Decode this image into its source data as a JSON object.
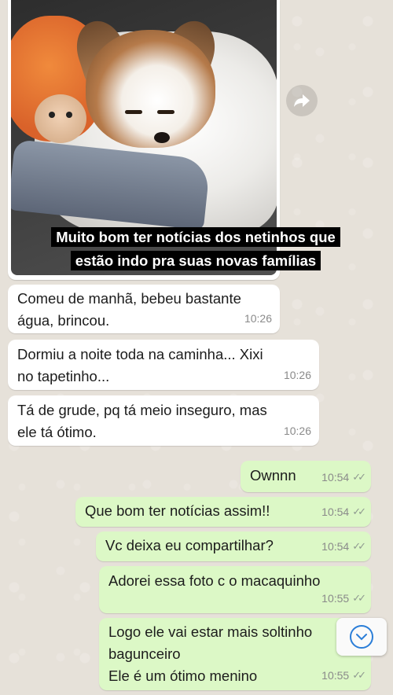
{
  "image_message": {
    "caption": "Muito bom ter notícias dos netinhos que estão indo pra suas novas famílias"
  },
  "icons": {
    "forward": "forward-arrow-icon",
    "scroll_down": "chevron-down-icon",
    "read_receipt": "double-check-icon"
  },
  "colors": {
    "incoming_bubble": "#ffffff",
    "outgoing_bubble": "#dcf8c6",
    "wallpaper": "#e6e1d9",
    "scroll_accent": "#2b7ed8"
  },
  "messages": [
    {
      "direction": "in",
      "text_lines": [
        "Comeu de manhã, bebeu bastante",
        "água, brincou."
      ],
      "time": "10:26"
    },
    {
      "direction": "in",
      "text_lines": [
        "Dormiu a noite toda na caminha... Xixi",
        "no tapetinho..."
      ],
      "time": "10:26"
    },
    {
      "direction": "in",
      "text_lines": [
        "Tá de grude, pq tá meio inseguro, mas",
        "ele tá ótimo."
      ],
      "time": "10:26"
    },
    {
      "direction": "out",
      "text_lines": [
        "Ownnn"
      ],
      "time": "10:54"
    },
    {
      "direction": "out",
      "text_lines": [
        "Que bom ter notícias assim!!"
      ],
      "time": "10:54"
    },
    {
      "direction": "out",
      "text_lines": [
        "Vc deixa eu compartilhar?"
      ],
      "time": "10:54"
    },
    {
      "direction": "out",
      "text_lines": [
        "Adorei essa foto c o macaquinho"
      ],
      "time": "10:55"
    },
    {
      "direction": "out",
      "text_lines": [
        "Logo ele vai estar mais soltinho",
        "bagunceiro",
        "Ele é um ótimo menino"
      ],
      "time": "10:55"
    }
  ],
  "tick_glyph": "✓✓"
}
